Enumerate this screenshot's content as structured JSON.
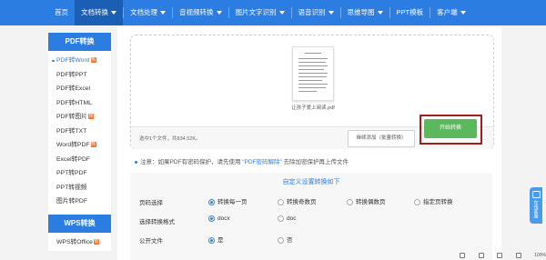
{
  "nav": {
    "items": [
      {
        "label": "首页",
        "caret": false,
        "active": false
      },
      {
        "label": "文档转换",
        "caret": true,
        "active": true
      },
      {
        "label": "文档处理",
        "caret": true,
        "active": false
      },
      {
        "label": "音视频转换",
        "caret": true,
        "active": false
      },
      {
        "label": "图片文字识别",
        "caret": true,
        "active": false
      },
      {
        "label": "语音识别",
        "caret": true,
        "active": false
      },
      {
        "label": "思维导图",
        "caret": true,
        "active": false
      },
      {
        "label": "PPT模板",
        "caret": false,
        "active": false
      },
      {
        "label": "客户端",
        "caret": true,
        "active": false
      }
    ]
  },
  "sidebar": {
    "pdf_header": "PDF转换",
    "pdf_items": [
      {
        "label": "PDF转Word",
        "hot": true,
        "active": true
      },
      {
        "label": "PDF转PPT",
        "hot": false,
        "active": false
      },
      {
        "label": "PDF转Excel",
        "hot": false,
        "active": false
      },
      {
        "label": "PDF转HTML",
        "hot": false,
        "active": false
      },
      {
        "label": "PDF转图片",
        "hot": true,
        "active": false
      },
      {
        "label": "PDF转TXT",
        "hot": false,
        "active": false
      },
      {
        "label": "Word转PDF",
        "hot": true,
        "active": false
      },
      {
        "label": "Excel转PDF",
        "hot": false,
        "active": false
      },
      {
        "label": "PPT转PDF",
        "hot": false,
        "active": false
      },
      {
        "label": "PPT转视频",
        "hot": false,
        "active": false
      },
      {
        "label": "图片转PDF",
        "hot": false,
        "active": false
      }
    ],
    "wps_header": "WPS转换",
    "wps_items": [
      {
        "label": "WPS转Office",
        "hot": true,
        "active": false
      }
    ],
    "hot_badge": "热"
  },
  "upload": {
    "file_name": "让孩子爱上阅读.pdf",
    "summary": "选中1个文件，共834.52K。",
    "add_button": "继续添加（批量转换）",
    "start_button": "开始转换"
  },
  "notice": {
    "prefix": "注意：如果PDF有密码保护，请先使用",
    "link": "“PDF密码解除”",
    "suffix": "去除加密保护再上传文件"
  },
  "settings": {
    "title": "自定义设置转换如下",
    "page_label": "页码选择",
    "page_options": [
      "转换每一页",
      "转换奇数页",
      "转换偶数页",
      "指定页转换"
    ],
    "page_selected": 0,
    "format_label": "选择转换格式",
    "format_options": [
      "docx",
      "doc"
    ],
    "format_selected": 0,
    "public_label": "公开文件",
    "public_options": [
      "是",
      "否"
    ],
    "public_selected": 0
  },
  "float_tab": {
    "label": "在线客服"
  },
  "statusbar": {
    "zoom": "100%"
  },
  "colors": {
    "primary": "#2b7de1",
    "active_nav": "#1a5fb4",
    "start_button": "#5cb85c",
    "highlight_frame": "#a01e1e"
  }
}
